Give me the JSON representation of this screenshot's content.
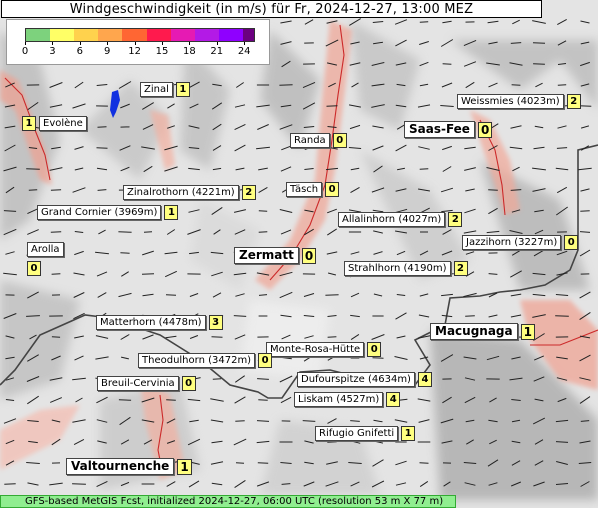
{
  "title": "Windgeschwindigkeit (in m/s) für Fr, 2024-12-27, 13:00 MEZ",
  "legend": {
    "ticks": [
      "0",
      "3",
      "6",
      "9",
      "12",
      "15",
      "18",
      "21",
      "24"
    ],
    "colors": [
      "#7dd27d",
      "#ffff66",
      "#ffd24d",
      "#ffa64d",
      "#ff6633",
      "#ff1a4d",
      "#e61ab3",
      "#b31ae6",
      "#8f00ff",
      "#6b0080"
    ]
  },
  "footer": "GFS-based MetGIS Fcst, initialized 2024-12-27, 06:00 UTC  (resolution 53 m X 77 m)",
  "places": [
    {
      "id": "zinal",
      "name": "Zinal",
      "value": "1"
    },
    {
      "id": "evolene",
      "name": "Evolène",
      "value": "1"
    },
    {
      "id": "weissmies",
      "name": "Weissmies (4023m)",
      "value": "2"
    },
    {
      "id": "saasfee",
      "name": "Saas-Fee",
      "value": "0"
    },
    {
      "id": "randa",
      "name": "Randa",
      "value": "0"
    },
    {
      "id": "tasch",
      "name": "Täsch",
      "value": "0"
    },
    {
      "id": "zinalrothorn",
      "name": "Zinalrothorn (4221m)",
      "value": "2"
    },
    {
      "id": "grandcornier",
      "name": "Grand Cornier (3969m)",
      "value": "1"
    },
    {
      "id": "allalinhorn",
      "name": "Allalinhorn (4027m)",
      "value": "2"
    },
    {
      "id": "jazzihorn",
      "name": "Jazzihorn (3227m)",
      "value": "0"
    },
    {
      "id": "arolla",
      "name": "Arolla",
      "value": "0"
    },
    {
      "id": "zermatt",
      "name": "Zermatt",
      "value": "0"
    },
    {
      "id": "strahlhorn",
      "name": "Strahlhorn (4190m)",
      "value": "2"
    },
    {
      "id": "matterhorn",
      "name": "Matterhorn (4478m)",
      "value": "3"
    },
    {
      "id": "macugnaga",
      "name": "Macugnaga",
      "value": "1"
    },
    {
      "id": "monterosa",
      "name": "Monte-Rosa-Hütte",
      "value": "0"
    },
    {
      "id": "theodulhorn",
      "name": "Theodulhorn (3472m)",
      "value": "0"
    },
    {
      "id": "breuil",
      "name": "Breuil-Cervinia",
      "value": "0"
    },
    {
      "id": "dufourspitze",
      "name": "Dufourspitze (4634m)",
      "value": "4"
    },
    {
      "id": "liskam",
      "name": "Liskam (4527m)",
      "value": "4"
    },
    {
      "id": "gnifetti",
      "name": "Rifugio Gnifetti",
      "value": "1"
    },
    {
      "id": "valtournenche",
      "name": "Valtournenche",
      "value": "1"
    }
  ]
}
